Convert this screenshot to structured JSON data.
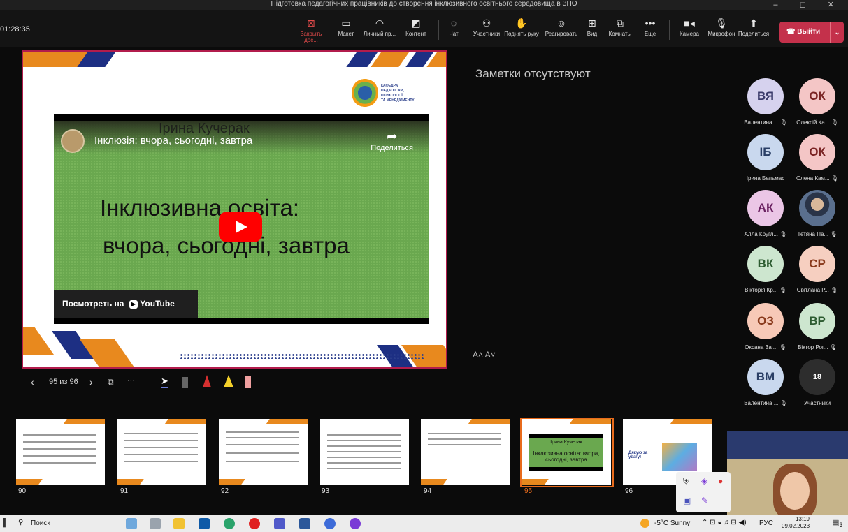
{
  "window": {
    "title": "Підготовка педагогічних працівників до створення інклюзивного освітнього середовища в ЗПО",
    "controls": "–  ◻  ✕"
  },
  "meeting": {
    "timer": "01:28:35"
  },
  "toolbar": {
    "stop": {
      "label": "Закрыть дос...",
      "icon": "stop-share-icon"
    },
    "layout": {
      "label": "Макет",
      "icon": "layout-icon"
    },
    "personal": {
      "label": "Личный пр...",
      "icon": "personal-icon"
    },
    "content": {
      "label": "Контент",
      "icon": "content-icon"
    },
    "chat": {
      "label": "Чат",
      "icon": "chat-icon"
    },
    "people": {
      "label": "Участники",
      "icon": "people-icon"
    },
    "hand": {
      "label": "Поднять руку",
      "icon": "hand-icon"
    },
    "react": {
      "label": "Реагировать",
      "icon": "smile-icon"
    },
    "view": {
      "label": "Вид",
      "icon": "view-icon"
    },
    "rooms": {
      "label": "Комнаты",
      "icon": "rooms-icon"
    },
    "more": {
      "label": "Еще",
      "icon": "more-icon"
    },
    "camera": {
      "label": "Камера",
      "icon": "camera-icon"
    },
    "mic": {
      "label": "Микрофон",
      "icon": "mic-icon"
    },
    "share": {
      "label": "Поделиться",
      "icon": "share-icon"
    },
    "leave": {
      "label": "Выйти",
      "icon": "phone-icon"
    }
  },
  "slide": {
    "logo_text": [
      "КАФЕДРА",
      "ПЕДАГОГІКИ,",
      "ПСИХОЛОГІЇ",
      "ТА МЕНЕДЖМЕНТУ"
    ],
    "video": {
      "ghost_name": "Ірина Кучерак",
      "title": "Інклюзія: вчора, сьогодні, завтра",
      "share": "Поделиться",
      "line1": "Інклюзивна освіта:",
      "line2": "вчора, сьогодні, завтра",
      "watch": "Посмотреть на",
      "yt": "YouTube"
    }
  },
  "notes": {
    "empty": "Заметки отсутствуют",
    "font_sizes": "A˄  A˅"
  },
  "slide_controls": {
    "counter": "95 из 96"
  },
  "participants": [
    {
      "initials": "ВЯ",
      "name": "Валентина ...",
      "color": "#d6d2ee",
      "fg": "#3a3a6a"
    },
    {
      "initials": "ОК",
      "name": "Олексій Ка...",
      "color": "#f4c6c6",
      "fg": "#7a2323"
    },
    {
      "initials": "ІБ",
      "name": "Ірина Бельмас",
      "color": "#c9d8ee",
      "fg": "#2a3f66"
    },
    {
      "initials": "ОК",
      "name": "Олена Кам...",
      "color": "#f4c6c6",
      "fg": "#7a2323"
    },
    {
      "initials": "АК",
      "name": "Алла Кругл...",
      "color": "#ebc6e6",
      "fg": "#6a2060"
    },
    {
      "initials": "",
      "name": "Тетяна Па...",
      "color": "#5a6f8e",
      "fg": "#fff"
    },
    {
      "initials": "ВК",
      "name": "Вікторія Кр...",
      "color": "#cde6cf",
      "fg": "#2c5b30"
    },
    {
      "initials": "СР",
      "name": "Світлана Р...",
      "color": "#f6cfc0",
      "fg": "#8a3a1c"
    },
    {
      "initials": "ОЗ",
      "name": "Оксана Заг...",
      "color": "#f7c9b7",
      "fg": "#8a3a1c"
    },
    {
      "initials": "ВР",
      "name": "Віктор Рог...",
      "color": "#cde6cf",
      "fg": "#2c5b30"
    },
    {
      "initials": "ВМ",
      "name": "Валентина ...",
      "color": "#c9d8ee",
      "fg": "#2a3f66"
    },
    {
      "initials": "18",
      "name": "Участники",
      "color": "#2d2d2d",
      "fg": "#fff"
    }
  ],
  "thumbnails": [
    "90",
    "91",
    "92",
    "93",
    "94",
    "95",
    "96"
  ],
  "thumb_95": {
    "name": "Ірина Кучерак",
    "title": "Інклюзивна освіта: вчора, сьогодні, завтра"
  },
  "thumb_96": {
    "text": "Дякую за увагу!"
  },
  "taskbar": {
    "search": "Поиск",
    "weather": "-5°C  Sunny",
    "lang": "РУС",
    "time": "13:19",
    "date": "09.02.2023",
    "notif": "3"
  }
}
